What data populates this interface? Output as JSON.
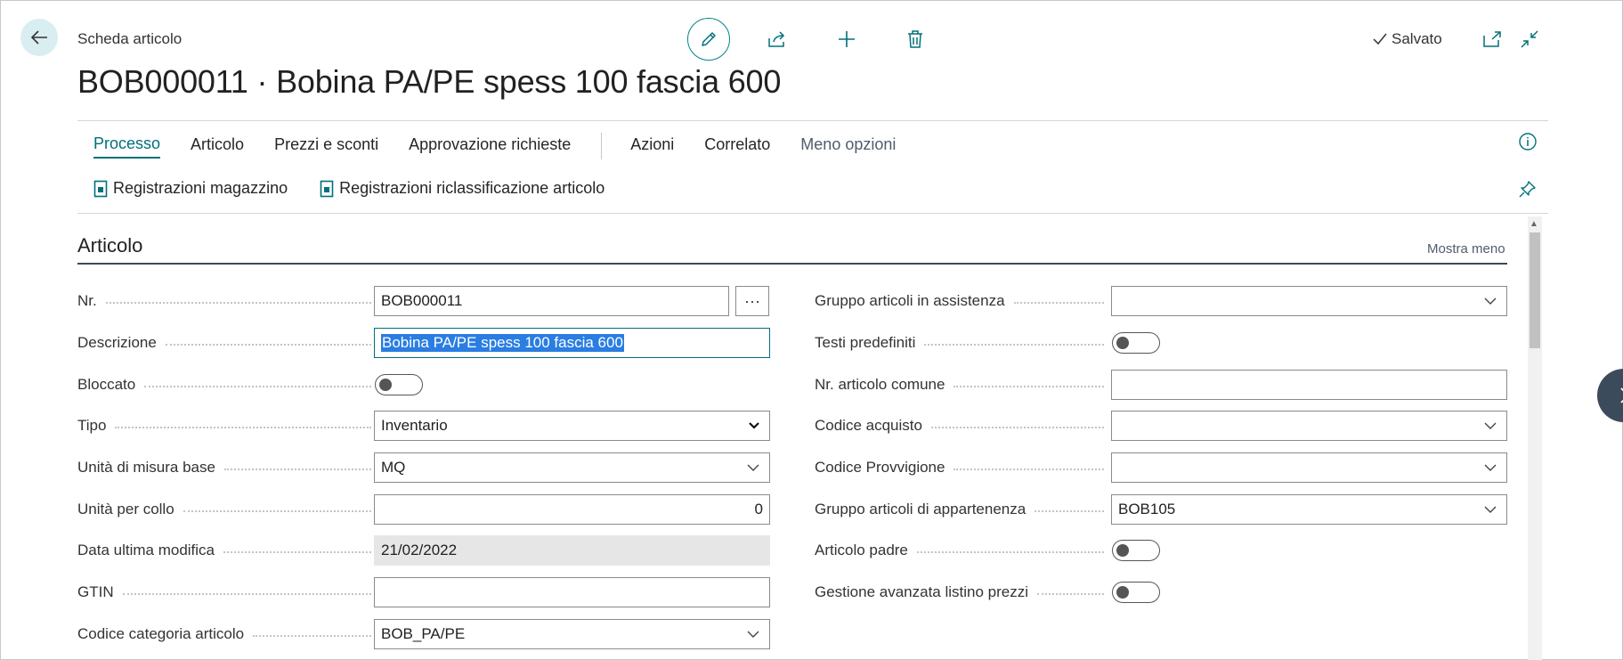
{
  "header": {
    "breadcrumb": "Scheda articolo",
    "title": "BOB000011 · Bobina PA/PE spess 100 fascia 600",
    "saved_label": "Salvato"
  },
  "actionbar": {
    "tabs": [
      "Processo",
      "Articolo",
      "Prezzi e sconti",
      "Approvazione richieste"
    ],
    "more_tabs": [
      "Azioni",
      "Correlato",
      "Meno opzioni"
    ],
    "actions": [
      "Registrazioni magazzino",
      "Registrazioni riclassificazione articolo"
    ]
  },
  "section": {
    "title": "Articolo",
    "toggle": "Mostra meno"
  },
  "left_fields": {
    "nr": {
      "label": "Nr.",
      "value": "BOB000011",
      "more": "···"
    },
    "descrizione": {
      "label": "Descrizione",
      "value": "Bobina PA/PE spess 100 fascia 600"
    },
    "bloccato": {
      "label": "Bloccato"
    },
    "tipo": {
      "label": "Tipo",
      "value": "Inventario"
    },
    "unita_base": {
      "label": "Unità di misura base",
      "value": "MQ"
    },
    "unita_collo": {
      "label": "Unità per collo",
      "value": "0"
    },
    "data_modifica": {
      "label": "Data ultima modifica",
      "value": "21/02/2022"
    },
    "gtin": {
      "label": "GTIN",
      "value": ""
    },
    "categoria": {
      "label": "Codice categoria articolo",
      "value": "BOB_PA/PE"
    }
  },
  "right_fields": {
    "gruppo_assistenza": {
      "label": "Gruppo articoli in assistenza",
      "value": ""
    },
    "testi": {
      "label": "Testi predefiniti"
    },
    "nr_comune": {
      "label": "Nr. articolo comune",
      "value": ""
    },
    "acquisto": {
      "label": "Codice acquisto",
      "value": ""
    },
    "provvigione": {
      "label": "Codice Provvigione",
      "value": ""
    },
    "gruppo_appartenenza": {
      "label": "Gruppo articoli di appartenenza",
      "value": "BOB105"
    },
    "padre": {
      "label": "Articolo padre"
    },
    "listino": {
      "label": "Gestione avanzata listino prezzi"
    }
  },
  "toggles": {
    "bloccato": false,
    "testi": false,
    "padre": false,
    "listino": false
  },
  "colors": {
    "accent": "#00707a",
    "selection": "#2a7de1",
    "section_line": "#3a4a5c"
  }
}
